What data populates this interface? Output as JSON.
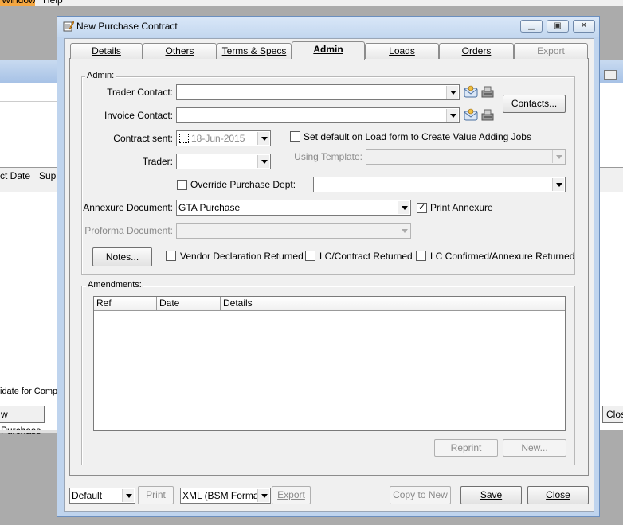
{
  "background": {
    "menu": [
      "Window",
      "Help"
    ],
    "grid_columns": [
      "ct Date",
      "Supp"
    ],
    "status_text": "idate for Compl",
    "left_button": "w Purchase",
    "right_button": "Clos"
  },
  "dialog": {
    "title": "New Purchase Contract",
    "tabs": [
      {
        "label": "Details",
        "state": "normal"
      },
      {
        "label": "Others",
        "state": "normal"
      },
      {
        "label": "Terms & Specs",
        "state": "normal"
      },
      {
        "label": "Admin",
        "state": "active"
      },
      {
        "label": "Loads",
        "state": "normal"
      },
      {
        "label": "Orders",
        "state": "normal"
      },
      {
        "label": "Export",
        "state": "disabled"
      }
    ],
    "admin": {
      "group_label": "Admin:",
      "trader_contact_label": "Trader Contact:",
      "trader_contact_value": "",
      "invoice_contact_label": "Invoice Contact:",
      "invoice_contact_value": "",
      "contacts_button": "Contacts...",
      "contract_sent_label": "Contract sent:",
      "contract_sent_value": "18-Jun-2015",
      "contract_sent_checked": false,
      "set_default_label": "Set default on Load form to Create Value Adding Jobs",
      "set_default_checked": false,
      "trader_label": "Trader:",
      "trader_value": "",
      "using_template_label": "Using Template:",
      "using_template_value": "",
      "override_label": "Override Purchase Dept:",
      "override_checked": false,
      "override_value": "",
      "annexure_label": "Annexure Document:",
      "annexure_value": "GTA Purchase",
      "print_annexure_label": "Print Annexure",
      "print_annexure_checked": true,
      "proforma_label": "Proforma Document:",
      "proforma_value": "",
      "notes_button": "Notes...",
      "vendor_decl_label": "Vendor Declaration Returned",
      "lc_contract_label": "LC/Contract Returned",
      "lc_confirmed_label": "LC Confirmed/Annexure Returned"
    },
    "amendments": {
      "group_label": "Amendments:",
      "columns": [
        "Ref",
        "Date",
        "Details"
      ],
      "reprint_button": "Reprint",
      "new_button": "New..."
    },
    "footer": {
      "layout_value": "Default",
      "print_button": "Print",
      "format_value": "XML (BSM Format)",
      "export_button": "Export",
      "copy_button": "Copy to New",
      "save_button": "Save",
      "close_button": "Close"
    }
  },
  "colors": {
    "titlebar": "#c3d7ef",
    "background": "#ababab",
    "face": "#f0f0f0"
  }
}
